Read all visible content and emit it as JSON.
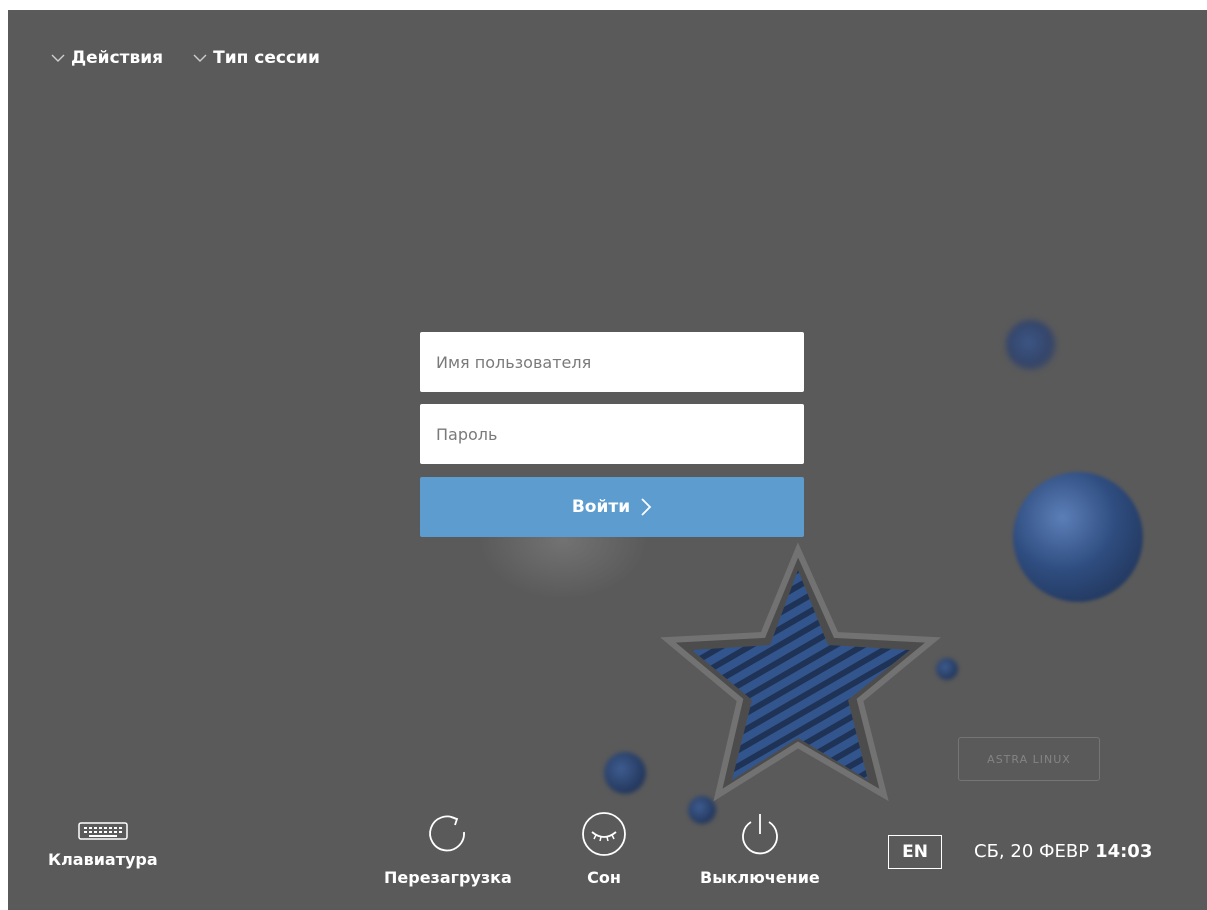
{
  "top_menu": {
    "actions_label": "Действия",
    "session_label": "Тип сессии"
  },
  "login": {
    "username_placeholder": "Имя пользователя",
    "password_placeholder": "Пароль",
    "submit_label": "Войти"
  },
  "bottom": {
    "keyboard_label": "Клавиатура",
    "reboot_label": "Перезагрузка",
    "sleep_label": "Сон",
    "power_label": "Выключение",
    "language": "EN",
    "date": "СБ, 20 ФЕВР",
    "time": "14:03"
  },
  "background_logo": "ASTRA LINUX",
  "colors": {
    "background": "#5a5a5a",
    "login_button": "#5d9ccf",
    "accent_blue": "#2f4d80"
  },
  "icons": {
    "menu_chevron": "chevron-down-icon",
    "keyboard": "keyboard-icon",
    "reboot": "reload-icon",
    "sleep": "sleep-icon",
    "power": "power-icon",
    "submit_arrow": "chevron-right-icon"
  }
}
